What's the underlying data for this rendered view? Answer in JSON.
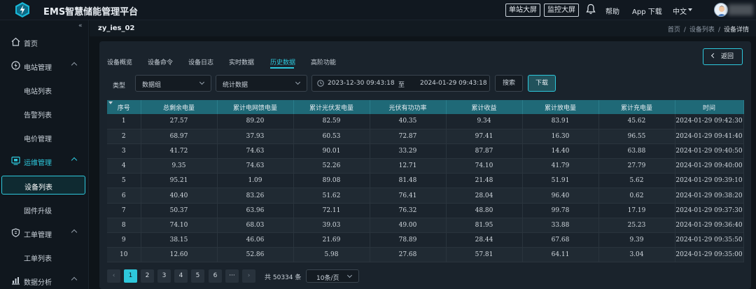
{
  "header": {
    "app_title": "EMS智慧储能管理平台",
    "single_station_btn": "单站大屏",
    "monitor_btn": "监控大屏",
    "help": "帮助",
    "app_download": "App 下载",
    "language": "中文",
    "icons": [
      "lightning-logo-icon",
      "bell-icon",
      "user-avatar"
    ]
  },
  "sidebar": {
    "collapse_icon": "«",
    "items": [
      {
        "label": "首页",
        "icon": "home-icon"
      },
      {
        "label": "电站管理",
        "icon": "power-station-icon"
      },
      {
        "label": "电站列表"
      },
      {
        "label": "告警列表"
      },
      {
        "label": "电价管理"
      },
      {
        "label": "运维管理",
        "icon": "operations-icon"
      },
      {
        "label": "设备列表"
      },
      {
        "label": "固件升级"
      },
      {
        "label": "工单管理",
        "icon": "shield-icon"
      },
      {
        "label": "工单列表"
      },
      {
        "label": "数据分析",
        "icon": "chart-icon"
      }
    ]
  },
  "breadcrumb": {
    "page_name": "zy_ies_02",
    "items": [
      "首页",
      "设备列表",
      "设备详情"
    ]
  },
  "tabs": [
    "设备概览",
    "设备命令",
    "设备日志",
    "实时数据",
    "历史数据",
    "高阶功能"
  ],
  "active_tab": "历史数据",
  "back_button": "返回",
  "filters": {
    "type_label": "类型",
    "type_value": "数据组",
    "stat_value": "统计数据",
    "date_start": "2023-12-30 09:43:18",
    "date_to": "至",
    "date_end": "2024-01-29 09:43:18",
    "search_btn": "搜索",
    "download_btn": "下载"
  },
  "table": {
    "columns": [
      "序号",
      "总剩余电量",
      "累计电网馈电量",
      "累计光伏发电量",
      "光伏有功功率",
      "累计收益",
      "累计放电量",
      "累计充电量",
      "时间"
    ],
    "rows": [
      [
        "1",
        "27.57",
        "89.20",
        "82.59",
        "40.35",
        "9.34",
        "83.91",
        "45.62",
        "2024-01-29 09:42:30"
      ],
      [
        "2",
        "68.97",
        "37.93",
        "60.53",
        "72.87",
        "97.41",
        "16.30",
        "96.55",
        "2024-01-29 09:41:40"
      ],
      [
        "3",
        "41.72",
        "74.63",
        "90.01",
        "33.29",
        "87.87",
        "14.40",
        "63.88",
        "2024-01-29 09:40:50"
      ],
      [
        "4",
        "9.35",
        "74.63",
        "52.26",
        "12.71",
        "74.10",
        "41.79",
        "27.79",
        "2024-01-29 09:40:00"
      ],
      [
        "5",
        "95.21",
        "1.09",
        "89.08",
        "81.48",
        "21.48",
        "51.91",
        "5.62",
        "2024-01-29 09:39:10"
      ],
      [
        "6",
        "40.40",
        "83.26",
        "51.62",
        "76.41",
        "28.04",
        "96.40",
        "0.62",
        "2024-01-29 09:38:20"
      ],
      [
        "7",
        "50.37",
        "63.96",
        "72.11",
        "76.32",
        "48.80",
        "99.78",
        "17.19",
        "2024-01-29 09:37:30"
      ],
      [
        "8",
        "74.10",
        "68.03",
        "39.03",
        "49.00",
        "81.95",
        "33.88",
        "25.23",
        "2024-01-29 09:36:40"
      ],
      [
        "9",
        "38.15",
        "46.06",
        "21.69",
        "78.89",
        "28.44",
        "67.68",
        "9.39",
        "2024-01-29 09:35:50"
      ],
      [
        "10",
        "12.60",
        "52.86",
        "5.98",
        "27.68",
        "57.81",
        "64.11",
        "3.04",
        "2024-01-29 09:35:00"
      ]
    ]
  },
  "pagination": {
    "prev": "‹",
    "pages": [
      "1",
      "2",
      "3",
      "4",
      "5",
      "6"
    ],
    "ellipsis": "···",
    "next": "›",
    "current_page": "1",
    "total_text": "共 50334 条",
    "page_size": "10条/页"
  },
  "colors": {
    "accent": "#2ec8dc",
    "header_bg": "#1f6977",
    "panel_bg": "#1a232c"
  }
}
